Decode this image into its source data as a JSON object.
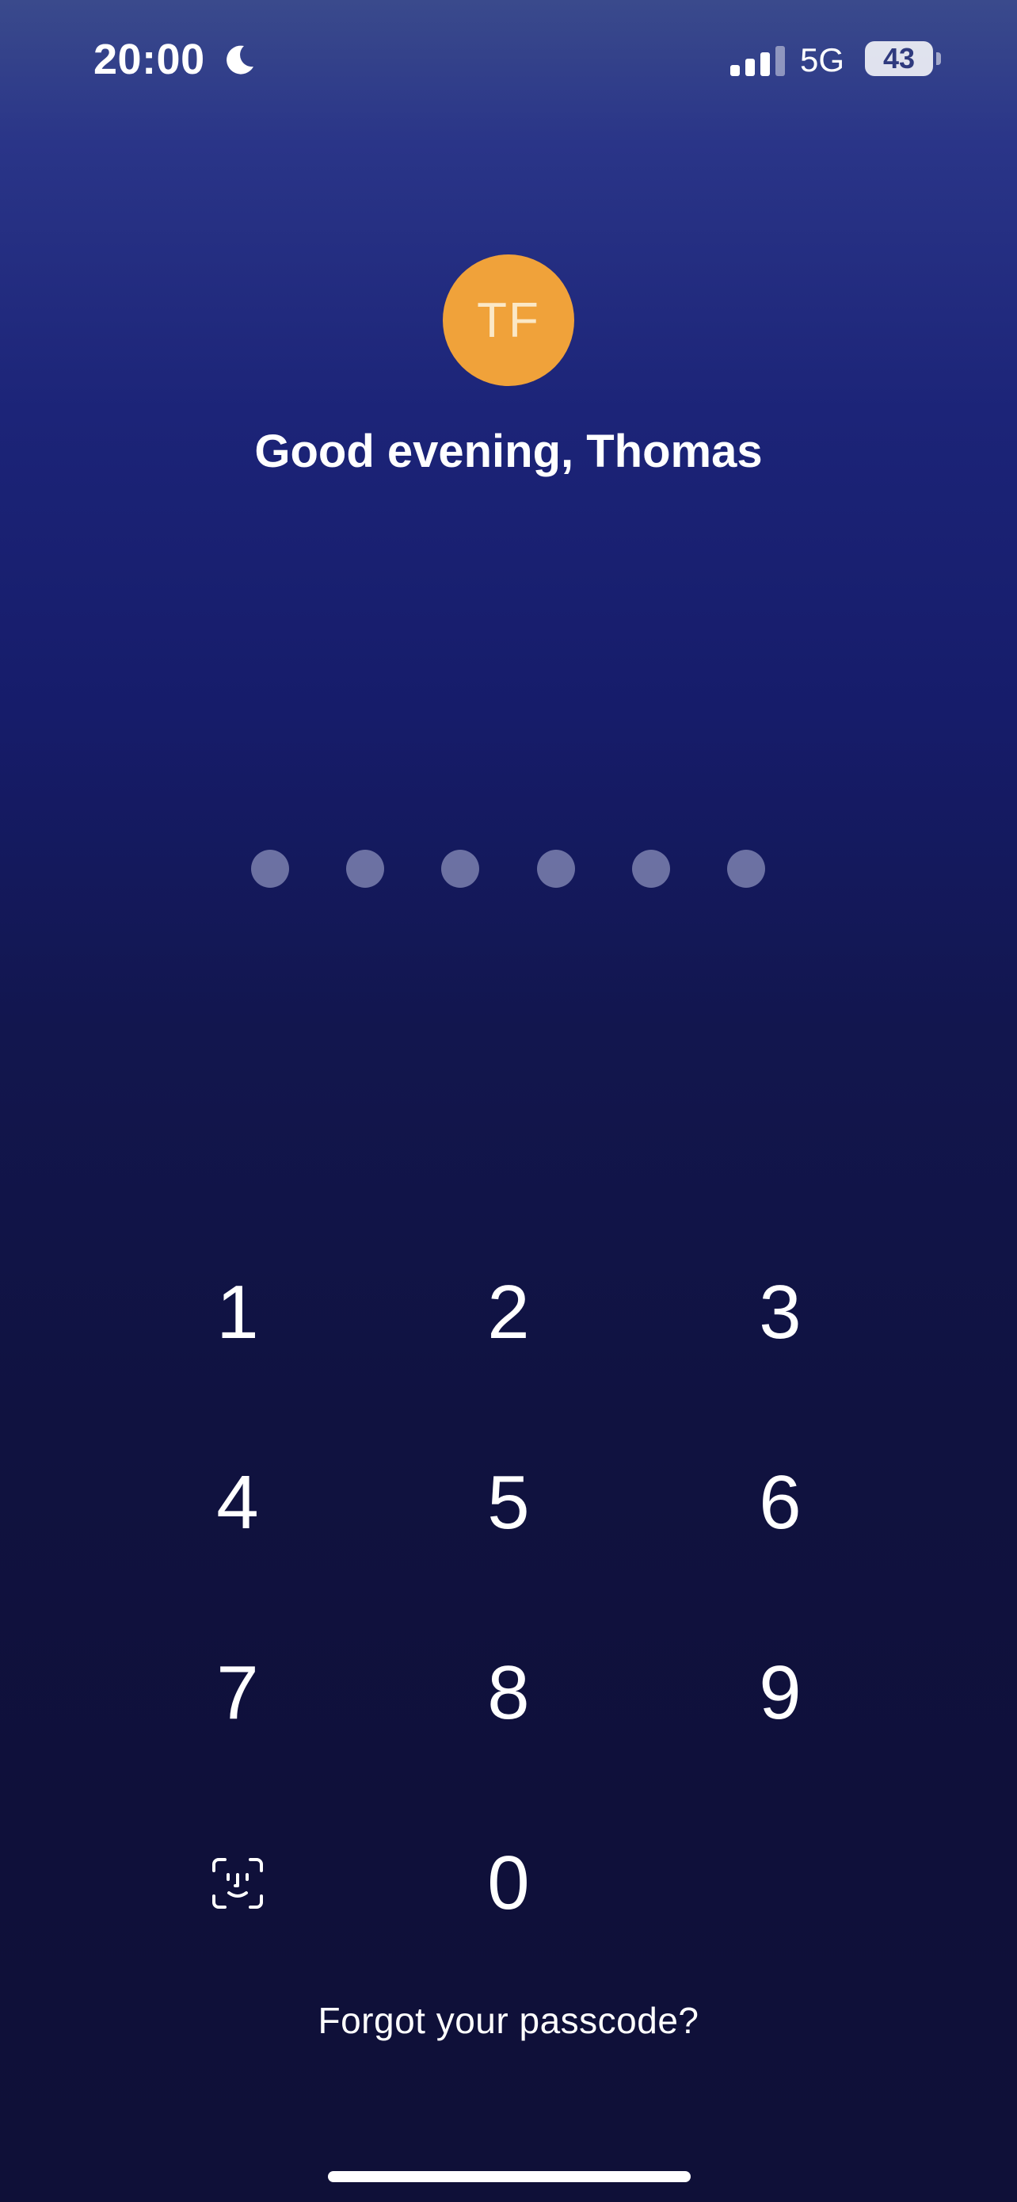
{
  "status_bar": {
    "time": "20:00",
    "moon_icon": "moon-icon",
    "signal_icon": "cellular-signal-icon",
    "network": "5G",
    "battery_level": "43"
  },
  "header": {
    "avatar_initials": "TF",
    "avatar_color": "#f0a23a",
    "greeting": "Good evening, Thomas"
  },
  "passcode": {
    "length": 6,
    "entered": 0
  },
  "keypad": {
    "keys": [
      "1",
      "2",
      "3",
      "4",
      "5",
      "6",
      "7",
      "8",
      "9",
      "0"
    ],
    "biometric_icon": "face-id-icon"
  },
  "forgot_link": "Forgot your passcode?",
  "colors": {
    "background_top": "#3a4a8c",
    "background_mid": "#161c6a",
    "background_bottom": "#0f1038",
    "accent": "#f0a23a"
  }
}
